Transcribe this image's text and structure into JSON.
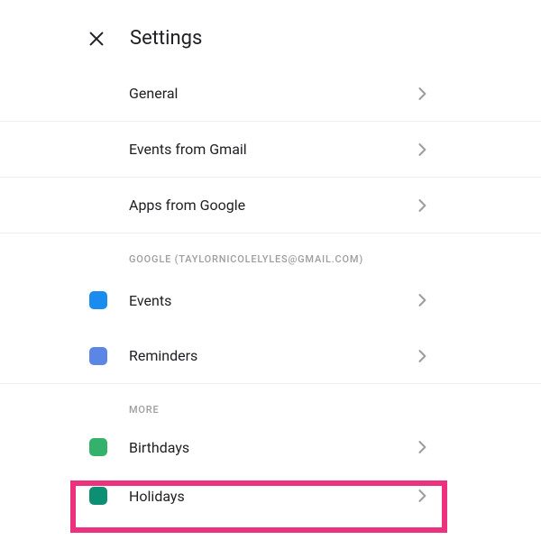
{
  "header": {
    "title": "Settings"
  },
  "sections": {
    "top": {
      "items": [
        {
          "label": "General"
        },
        {
          "label": "Events from Gmail"
        },
        {
          "label": "Apps from Google"
        }
      ]
    },
    "account": {
      "header": "GOOGLE (TAYLORNICOLELYLES@GMAIL.COM)",
      "items": [
        {
          "label": "Events",
          "color": "#1a8cf0"
        },
        {
          "label": "Reminders",
          "color": "#5c86e6"
        }
      ]
    },
    "more": {
      "header": "MORE",
      "items": [
        {
          "label": "Birthdays",
          "color": "#34b26b"
        },
        {
          "label": "Holidays",
          "color": "#0d8f73"
        }
      ]
    }
  },
  "highlight_color": "#ec317e"
}
